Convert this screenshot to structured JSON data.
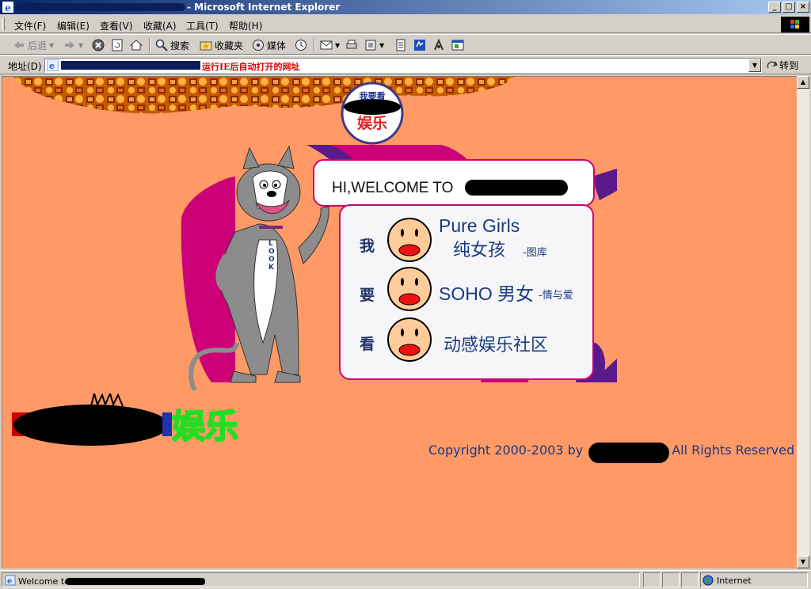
{
  "window": {
    "title": "- Microsoft Internet Explorer",
    "controls": {
      "minimize": "_",
      "maximize": "□",
      "close": "×"
    }
  },
  "menubar": {
    "items": [
      "文件(F)",
      "编辑(E)",
      "查看(V)",
      "收藏(A)",
      "工具(T)",
      "帮助(H)"
    ]
  },
  "toolbar": {
    "back": "后退",
    "search": "搜索",
    "favorites": "收藏夹",
    "media": "媒体"
  },
  "addressbar": {
    "label": "地址(D)",
    "url_note": "运行IE后自动打开的网址",
    "go": "转到"
  },
  "page": {
    "badge_top": "我要看",
    "badge_bottom": "娱乐",
    "welcome": "HI,WELCOME TO",
    "cat_tag": "LOOK",
    "side_chars": [
      "我",
      "要",
      "看"
    ],
    "entries": [
      {
        "main": "Pure Girls",
        "sub": "纯女孩",
        "tag": "-图库"
      },
      {
        "main": "SOHO 男女",
        "sub": "",
        "tag": "-情与爱"
      },
      {
        "main": "",
        "sub": "动感娱乐社区",
        "tag": ""
      }
    ],
    "site_logo_text": "娱乐",
    "copyright": "Copyright 2000-2003 by",
    "rights": "All Rights Reserved"
  },
  "statusbar": {
    "text": "Welcome to",
    "zone": "Internet"
  },
  "colors": {
    "page_bg": "#ff9966",
    "accent_magenta": "#cc0077",
    "accent_purple": "#5a1a8c",
    "link_blue": "#1a3a80"
  }
}
